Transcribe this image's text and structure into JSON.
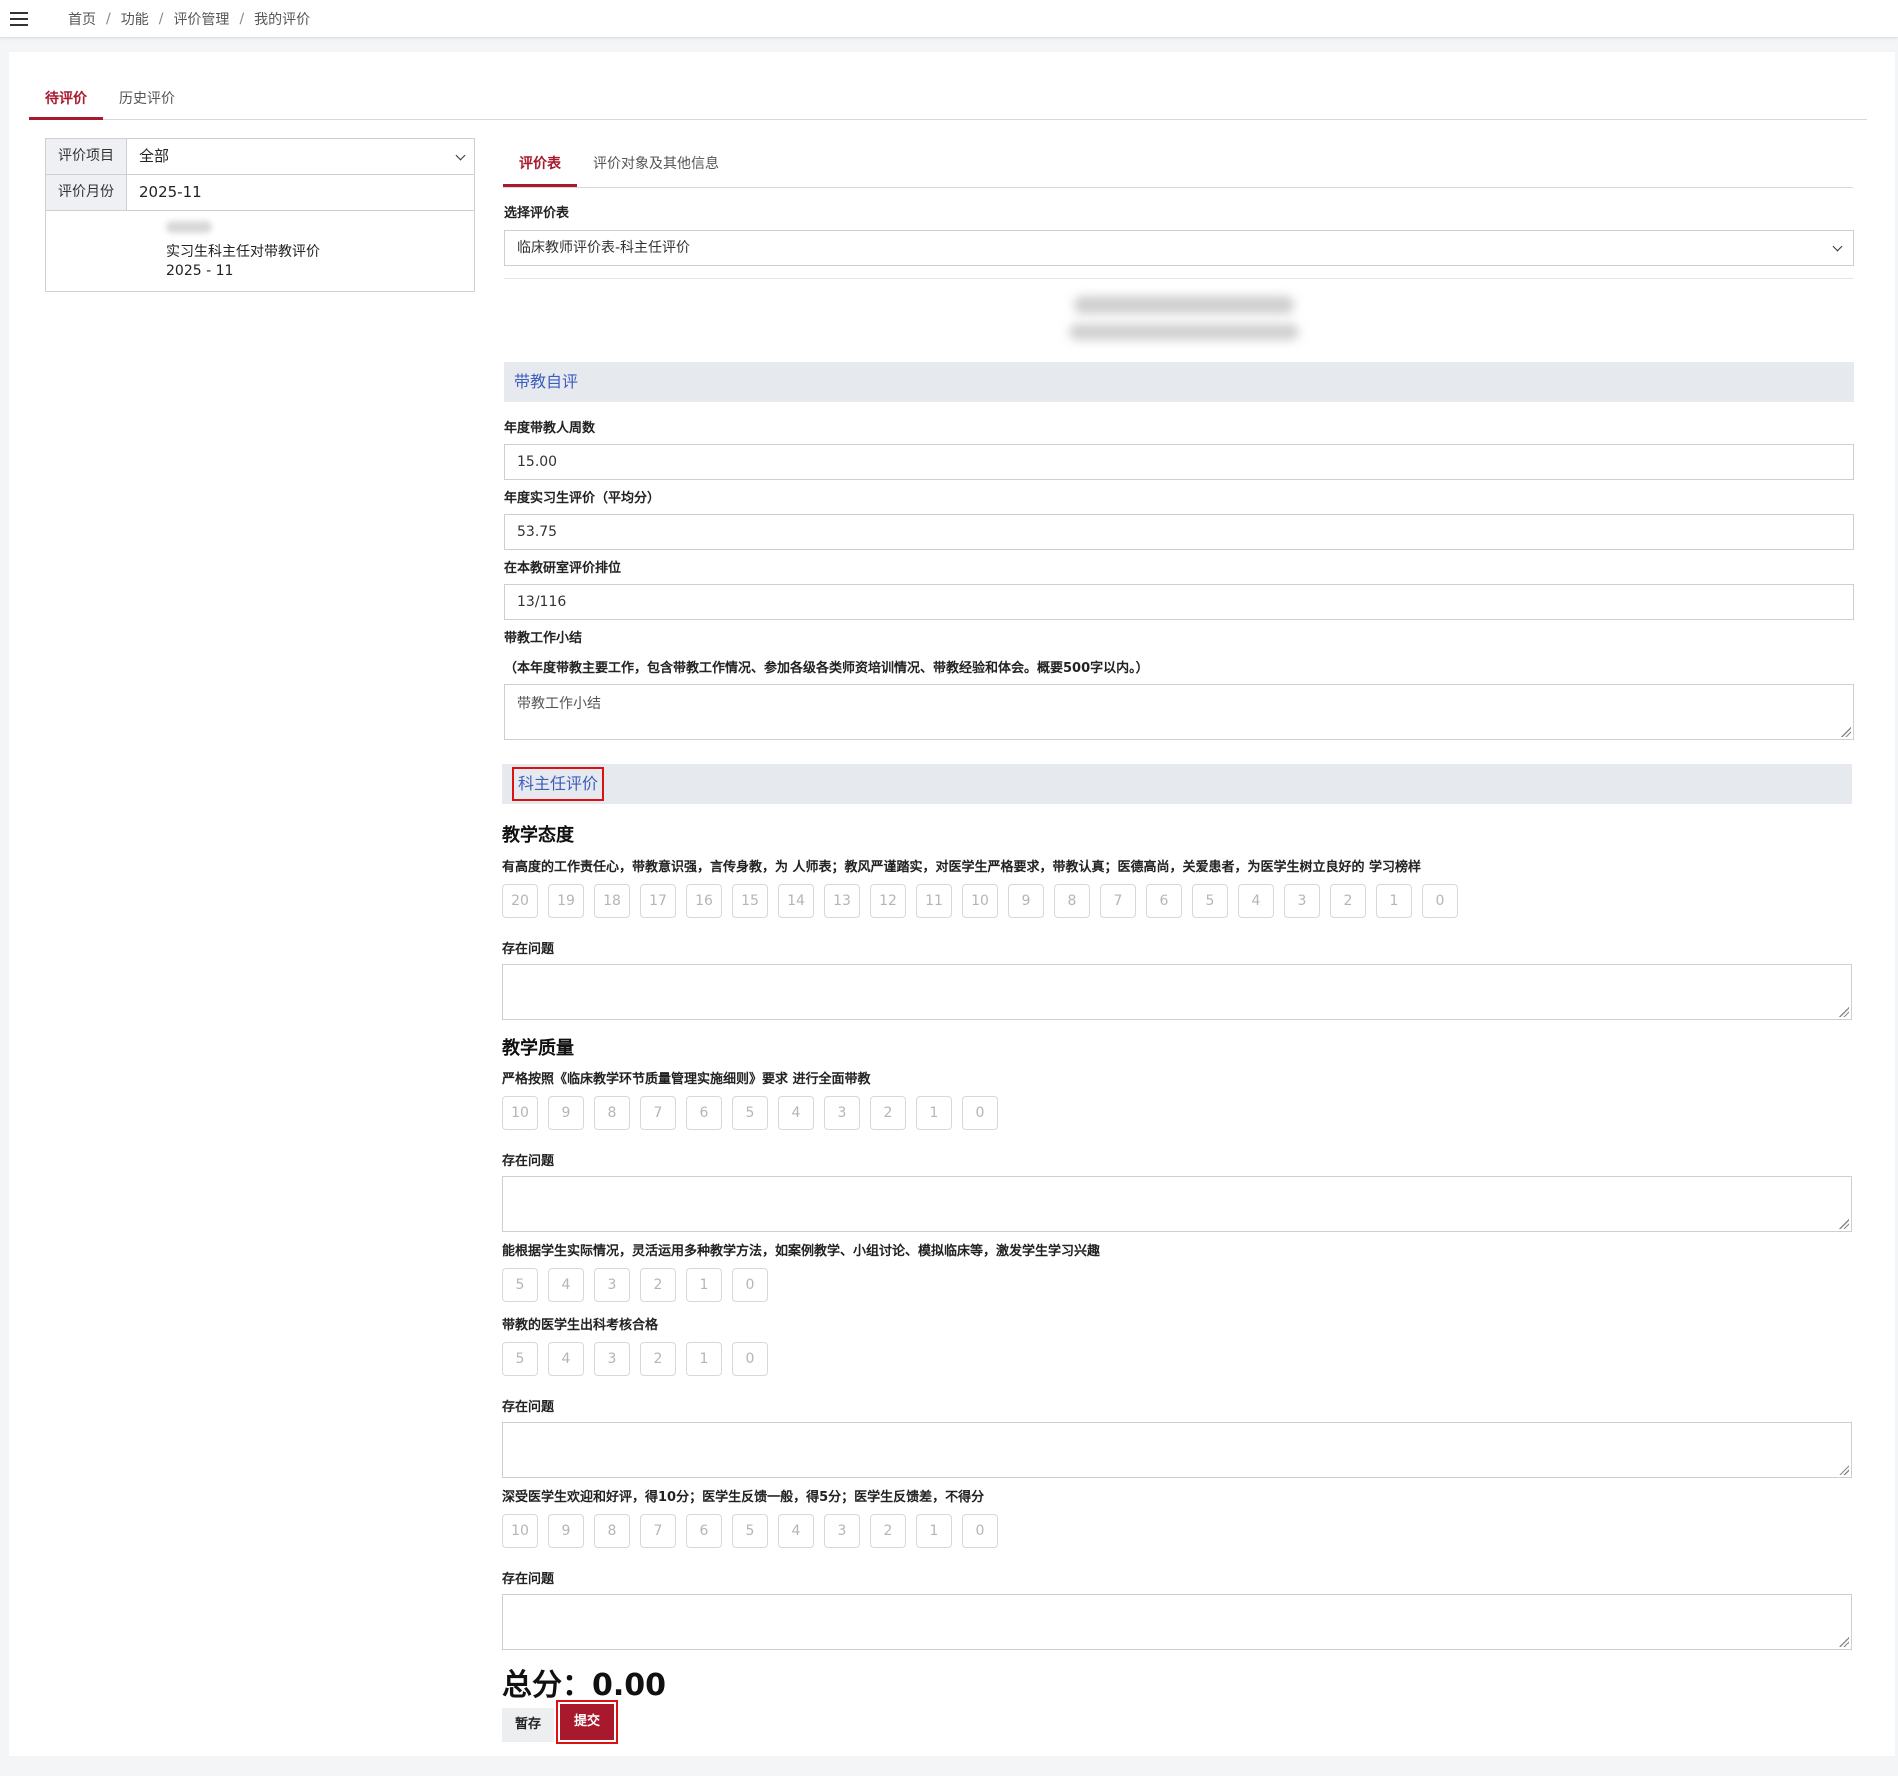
{
  "breadcrumb": [
    "首页",
    "功能",
    "评价管理",
    "我的评价"
  ],
  "main_tabs": [
    {
      "label": "待评价"
    },
    {
      "label": "历史评价"
    }
  ],
  "filter": {
    "project_label": "评价项目",
    "project_value": "全部",
    "month_label": "评价月份",
    "month_value": "2025-11"
  },
  "list_item": {
    "title": "实习生科主任对带教评价",
    "date": "2025 - 11"
  },
  "sub_tabs": [
    {
      "label": "评价表"
    },
    {
      "label": "评价对象及其他信息"
    }
  ],
  "form_select": {
    "label": "选择评价表",
    "value": "临床教师评价表-科主任评价"
  },
  "self_eval": {
    "title": "带教自评",
    "fields": [
      {
        "label": "年度带教人周数",
        "value": "15.00"
      },
      {
        "label": "年度实习生评价（平均分）",
        "value": "53.75"
      },
      {
        "label": "在本教研室评价排位",
        "value": "13/116"
      }
    ],
    "summary_label": "带教工作小结",
    "summary_hint": "（本年度带教主要工作，包含带教工作情况、参加各级各类师资培训情况、带教经验和体会。概要500字以内。）",
    "summary_placeholder": "带教工作小结"
  },
  "director_eval": {
    "title": "科主任评价",
    "issue_label": "存在问题",
    "criteria": [
      {
        "heading": "教学态度",
        "desc": "有高度的工作责任心，带教意识强，言传身教，为 人师表；教风严谨踏实，对医学生严格要求，带教认真；医德高尚，关爱患者，为医学生树立良好的 学习榜样",
        "scores": [
          "20",
          "19",
          "18",
          "17",
          "16",
          "15",
          "14",
          "13",
          "12",
          "11",
          "10",
          "9",
          "8",
          "7",
          "6",
          "5",
          "4",
          "3",
          "2",
          "1",
          "0"
        ]
      },
      {
        "heading": "教学质量",
        "desc": "严格按照《临床教学环节质量管理实施细则》要求 进行全面带教",
        "scores": [
          "10",
          "9",
          "8",
          "7",
          "6",
          "5",
          "4",
          "3",
          "2",
          "1",
          "0"
        ]
      },
      {
        "desc": "能根据学生实际情况，灵活运用多种教学方法，如案例教学、小组讨论、模拟临床等，激发学生学习兴趣",
        "scores": [
          "5",
          "4",
          "3",
          "2",
          "1",
          "0"
        ]
      },
      {
        "desc": "带教的医学生出科考核合格",
        "scores": [
          "5",
          "4",
          "3",
          "2",
          "1",
          "0"
        ]
      },
      {
        "desc": "深受医学生欢迎和好评，得10分；医学生反馈一般，得5分；医学生反馈差，不得分",
        "scores": [
          "10",
          "9",
          "8",
          "7",
          "6",
          "5",
          "4",
          "3",
          "2",
          "1",
          "0"
        ]
      }
    ]
  },
  "total": {
    "label": "总分：",
    "value": "0.00"
  },
  "buttons": {
    "save": "暂存",
    "submit": "提交"
  },
  "colors": {
    "accent": "#a8192e",
    "section_title": "#3d5dbf",
    "highlight": "#dd1111"
  }
}
